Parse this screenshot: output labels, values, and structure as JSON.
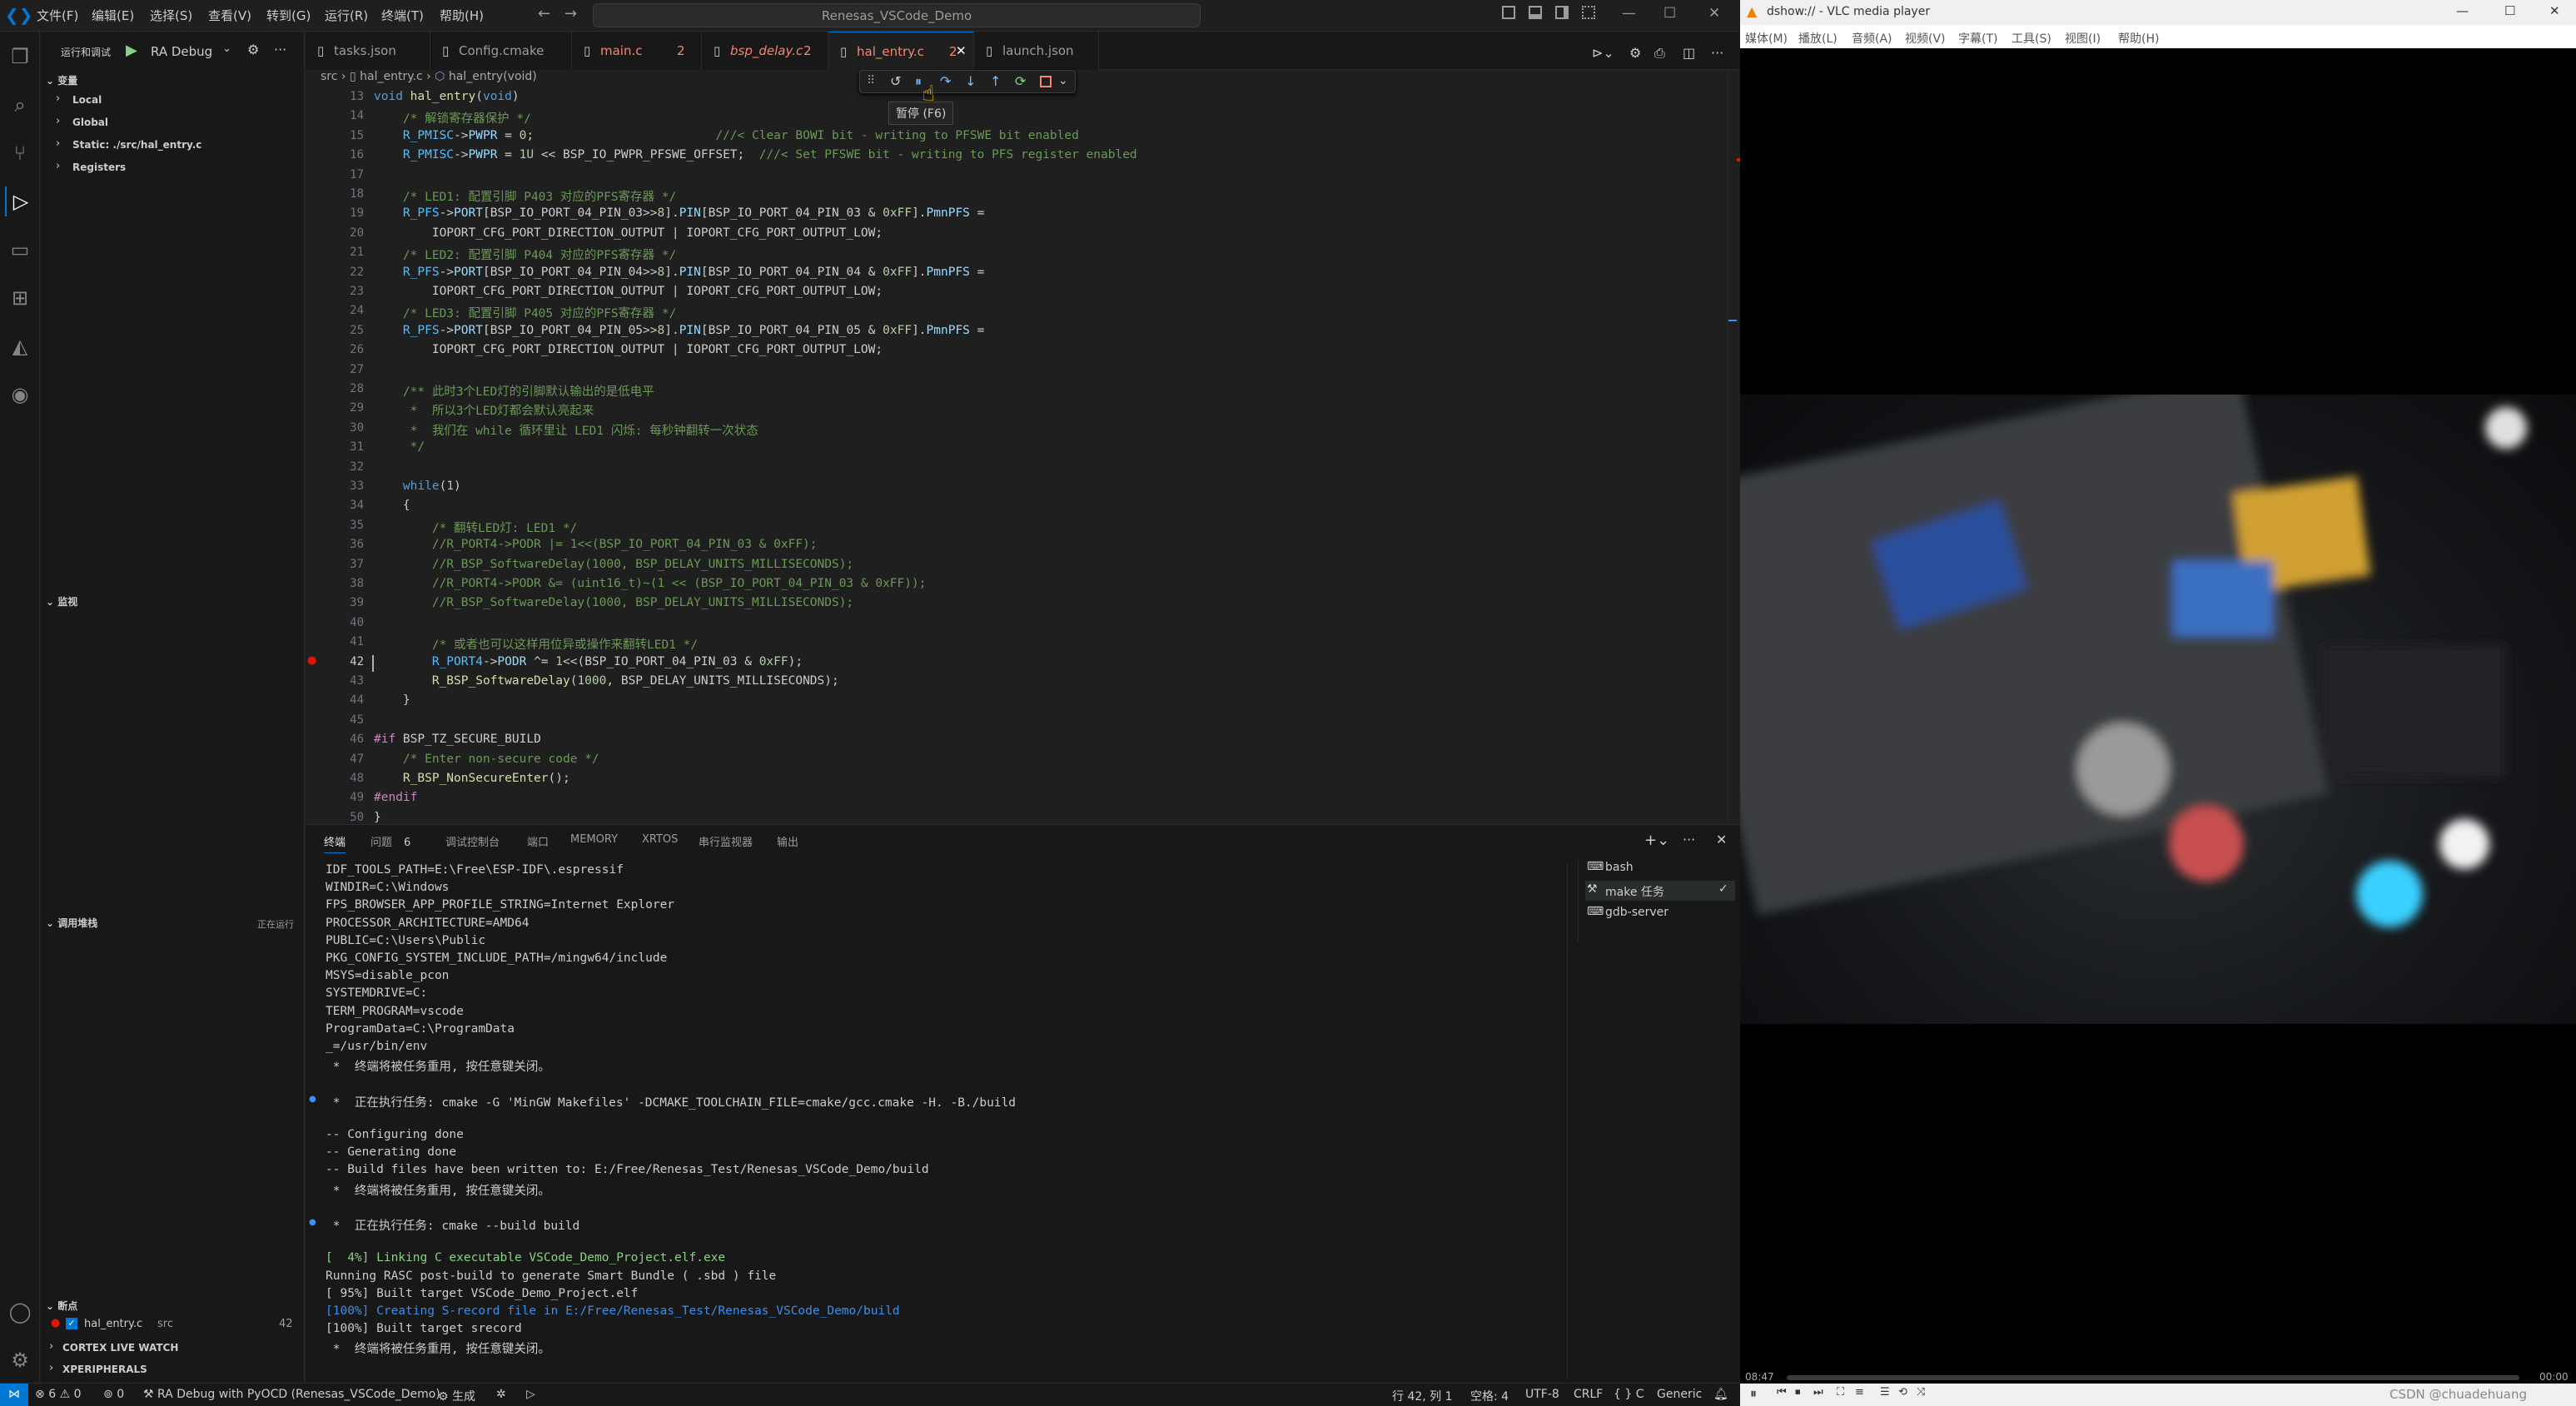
{
  "vscode": {
    "menu": [
      "文件(F)",
      "编辑(E)",
      "选择(S)",
      "查看(V)",
      "转到(G)",
      "运行(R)",
      "终端(T)",
      "帮助(H)"
    ],
    "command_center": "Renesas_VSCode_Demo",
    "run_debug": {
      "title": "运行和调试",
      "config": "RA Debug"
    },
    "variables": {
      "header": "变量",
      "items": [
        "Local",
        "Global",
        "Static: ./src/hal_entry.c",
        "Registers"
      ]
    },
    "watch": {
      "header": "监视"
    },
    "callstack": {
      "header": "调用堆栈",
      "status": "正在运行"
    },
    "breakpoints": {
      "header": "断点",
      "file": "hal_entry.c",
      "dir": "src",
      "line": "42"
    },
    "other_sections": [
      "CORTEX LIVE WATCH",
      "XPERIPHERALS"
    ],
    "tabs": [
      {
        "label": "tasks.json",
        "badge": ""
      },
      {
        "label": "Config.cmake",
        "badge": ""
      },
      {
        "label": "main.c",
        "badge": "2"
      },
      {
        "label": "bsp_delay.c",
        "badge": "2"
      },
      {
        "label": "hal_entry.c",
        "badge": "2"
      },
      {
        "label": "launch.json",
        "badge": ""
      }
    ],
    "breadcrumb": [
      "src",
      "hal_entry.c",
      "hal_entry(void)"
    ],
    "tooltip": "暂停 (F6)",
    "code_lines": [
      {
        "n": "13",
        "t": "void hal_entry(void)"
      },
      {
        "n": "14",
        "t": "    /* 解锁寄存器保护 */"
      },
      {
        "n": "15",
        "t": "    R_PMISC->PWPR = 0;                         ///< Clear BOWI bit - writing to PFSWE bit enabled"
      },
      {
        "n": "16",
        "t": "    R_PMISC->PWPR = 1U << BSP_IO_PWPR_PFSWE_OFFSET;  ///< Set PFSWE bit - writing to PFS register enabled"
      },
      {
        "n": "17",
        "t": ""
      },
      {
        "n": "18",
        "t": "    /* LED1: 配置引脚 P403 对应的PFS寄存器 */"
      },
      {
        "n": "19",
        "t": "    R_PFS->PORT[BSP_IO_PORT_04_PIN_03>>8].PIN[BSP_IO_PORT_04_PIN_03 & 0xFF].PmnPFS ="
      },
      {
        "n": "20",
        "t": "        IOPORT_CFG_PORT_DIRECTION_OUTPUT | IOPORT_CFG_PORT_OUTPUT_LOW;"
      },
      {
        "n": "21",
        "t": "    /* LED2: 配置引脚 P404 对应的PFS寄存器 */"
      },
      {
        "n": "22",
        "t": "    R_PFS->PORT[BSP_IO_PORT_04_PIN_04>>8].PIN[BSP_IO_PORT_04_PIN_04 & 0xFF].PmnPFS ="
      },
      {
        "n": "23",
        "t": "        IOPORT_CFG_PORT_DIRECTION_OUTPUT | IOPORT_CFG_PORT_OUTPUT_LOW;"
      },
      {
        "n": "24",
        "t": "    /* LED3: 配置引脚 P405 对应的PFS寄存器 */"
      },
      {
        "n": "25",
        "t": "    R_PFS->PORT[BSP_IO_PORT_04_PIN_05>>8].PIN[BSP_IO_PORT_04_PIN_05 & 0xFF].PmnPFS ="
      },
      {
        "n": "26",
        "t": "        IOPORT_CFG_PORT_DIRECTION_OUTPUT | IOPORT_CFG_PORT_OUTPUT_LOW;"
      },
      {
        "n": "27",
        "t": ""
      },
      {
        "n": "28",
        "t": "    /** 此时3个LED灯的引脚默认输出的是低电平"
      },
      {
        "n": "29",
        "t": "     *  所以3个LED灯都会默认亮起来"
      },
      {
        "n": "30",
        "t": "     *  我们在 while 循环里让 LED1 闪烁: 每秒钟翻转一次状态"
      },
      {
        "n": "31",
        "t": "     */"
      },
      {
        "n": "32",
        "t": ""
      },
      {
        "n": "33",
        "t": "    while(1)"
      },
      {
        "n": "34",
        "t": "    {"
      },
      {
        "n": "35",
        "t": "        /* 翻转LED灯: LED1 */"
      },
      {
        "n": "36",
        "t": "        //R_PORT4->PODR |= 1<<(BSP_IO_PORT_04_PIN_03 & 0xFF);"
      },
      {
        "n": "37",
        "t": "        //R_BSP_SoftwareDelay(1000, BSP_DELAY_UNITS_MILLISECONDS);"
      },
      {
        "n": "38",
        "t": "        //R_PORT4->PODR &= (uint16_t)~(1 << (BSP_IO_PORT_04_PIN_03 & 0xFF));"
      },
      {
        "n": "39",
        "t": "        //R_BSP_SoftwareDelay(1000, BSP_DELAY_UNITS_MILLISECONDS);"
      },
      {
        "n": "40",
        "t": ""
      },
      {
        "n": "41",
        "t": "        /* 或者也可以这样用位异或操作来翻转LED1 */"
      },
      {
        "n": "42",
        "t": "        R_PORT4->PODR ^= 1<<(BSP_IO_PORT_04_PIN_03 & 0xFF);"
      },
      {
        "n": "43",
        "t": "        R_BSP_SoftwareDelay(1000, BSP_DELAY_UNITS_MILLISECONDS);"
      },
      {
        "n": "44",
        "t": "    }"
      },
      {
        "n": "45",
        "t": ""
      },
      {
        "n": "46",
        "t": "#if BSP_TZ_SECURE_BUILD"
      },
      {
        "n": "47",
        "t": "    /* Enter non-secure code */"
      },
      {
        "n": "48",
        "t": "    R_BSP_NonSecureEnter();"
      },
      {
        "n": "49",
        "t": "#endif"
      },
      {
        "n": "50",
        "t": "}"
      }
    ],
    "panel_tabs": [
      {
        "label": "终端",
        "badge": ""
      },
      {
        "label": "问题",
        "badge": "6"
      },
      {
        "label": "调试控制台",
        "badge": ""
      },
      {
        "label": "端口",
        "badge": ""
      },
      {
        "label": "MEMORY",
        "badge": ""
      },
      {
        "label": "XRTOS",
        "badge": ""
      },
      {
        "label": "串行监视器",
        "badge": ""
      },
      {
        "label": "输出",
        "badge": ""
      }
    ],
    "terminal_lines": [
      "IDF_TOOLS_PATH=E:\\Free\\ESP-IDF\\.espressif",
      "WINDIR=C:\\Windows",
      "FPS_BROWSER_APP_PROFILE_STRING=Internet Explorer",
      "PROCESSOR_ARCHITECTURE=AMD64",
      "PUBLIC=C:\\Users\\Public",
      "PKG_CONFIG_SYSTEM_INCLUDE_PATH=/mingw64/include",
      "MSYS=disable_pcon",
      "SYSTEMDRIVE=C:",
      "TERM_PROGRAM=vscode",
      "ProgramData=C:\\ProgramData",
      "_=/usr/bin/env",
      " *  终端将被任务重用, 按任意键关闭。",
      "",
      " *  正在执行任务: cmake -G 'MinGW Makefiles' -DCMAKE_TOOLCHAIN_FILE=cmake/gcc.cmake -H. -B./build",
      "",
      "-- Configuring done",
      "-- Generating done",
      "-- Build files have been written to: E:/Free/Renesas_Test/Renesas_VSCode_Demo/build",
      " *  终端将被任务重用, 按任意键关闭。",
      "",
      " *  正在执行任务: cmake --build build",
      "",
      "[  4%] Linking C executable VSCode_Demo_Project.elf.exe",
      "Running RASC post-build to generate Smart Bundle ( .sbd ) file",
      "[ 95%] Built target VSCode_Demo_Project.elf",
      "[100%] Creating S-record file in E:/Free/Renesas_Test/Renesas_VSCode_Demo/build",
      "[100%] Built target srecord",
      " *  终端将被任务重用, 按任意键关闭。"
    ],
    "terminals": [
      "bash",
      "make 任务",
      "gdb-server"
    ],
    "statusbar": {
      "errors": "6",
      "warnings": "0",
      "ports": "0",
      "debug": "RA Debug with PyOCD (Renesas_VSCode_Demo)",
      "build": "生成",
      "position": "行 42, 列 1",
      "spaces": "空格: 4",
      "encoding": "UTF-8",
      "eol": "CRLF",
      "lang": "{ } C",
      "platform": "Generic"
    }
  },
  "vlc": {
    "title": "dshow:// - VLC media player",
    "menu": [
      "媒体(M)",
      "播放(L)",
      "音频(A)",
      "视频(V)",
      "字幕(T)",
      "工具(S)",
      "视图(I)",
      "帮助(H)"
    ],
    "time_elapsed": "08:47",
    "time_total": "00:00",
    "watermark": "CSDN @chuadehuang"
  },
  "colors": {
    "accent": "#0078d4",
    "breakpoint": "#e51400",
    "keyword": "#c586c0",
    "function": "#dcdcaa",
    "macro": "#4fc1ff",
    "comment": "#6a9955",
    "number": "#b5cea8"
  }
}
